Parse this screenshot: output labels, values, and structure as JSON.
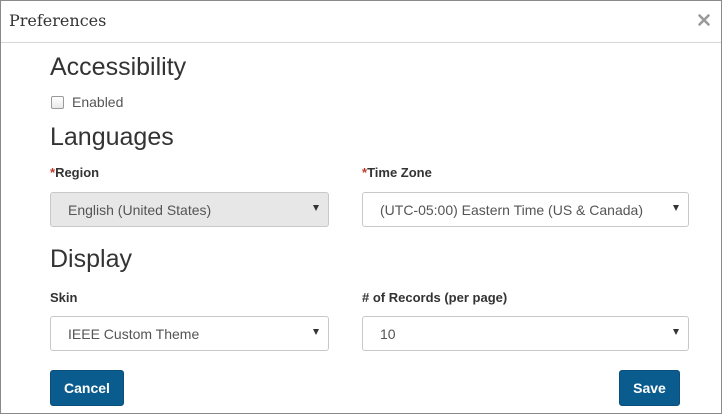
{
  "dialog": {
    "title": "Preferences",
    "close_icon": "close-icon"
  },
  "accessibility": {
    "heading": "Accessibility",
    "enabled_label": "Enabled",
    "enabled_checked": false
  },
  "languages": {
    "heading": "Languages",
    "region": {
      "required_mark": "*",
      "label": "Region",
      "value": "English (United States)",
      "disabled": true
    },
    "time_zone": {
      "required_mark": "*",
      "label": "Time Zone",
      "value": "(UTC-05:00) Eastern Time (US & Canada)"
    }
  },
  "display": {
    "heading": "Display",
    "skin": {
      "label": "Skin",
      "value": "IEEE Custom Theme"
    },
    "records": {
      "label": "# of Records (per page)",
      "value": "10"
    }
  },
  "actions": {
    "cancel_label": "Cancel",
    "save_label": "Save"
  },
  "colors": {
    "button_primary": "#0b5c8e",
    "required_mark": "#c0392b",
    "disabled_field_bg": "#e7e7e7"
  }
}
